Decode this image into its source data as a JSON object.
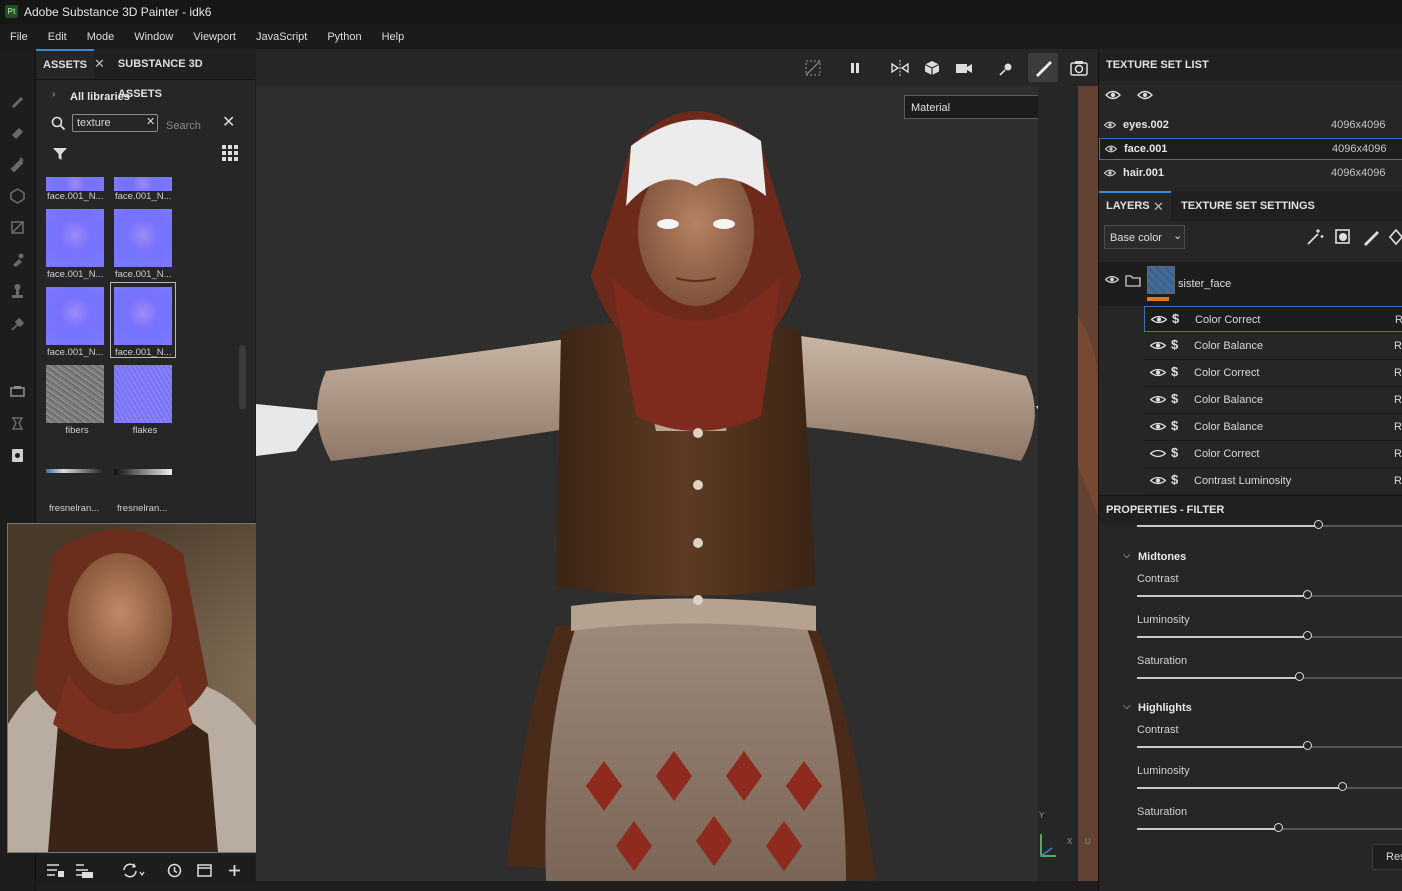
{
  "app": {
    "title": "Adobe Substance 3D Painter - idk6",
    "logo_text": "Pt"
  },
  "menu": [
    "File",
    "Edit",
    "Mode",
    "Window",
    "Viewport",
    "JavaScript",
    "Python",
    "Help"
  ],
  "assets": {
    "tabs": [
      "ASSETS",
      "SUBSTANCE 3D ASSETS"
    ],
    "breadcrumb": "All libraries",
    "search_value": "texture",
    "search_placeholder": "Search",
    "items": [
      {
        "label": "face.001_N...",
        "type": "normal",
        "cropped": true
      },
      {
        "label": "face.001_N...",
        "type": "normal",
        "cropped": true
      },
      {
        "label": "face.001_N...",
        "type": "normal"
      },
      {
        "label": "face.001_N...",
        "type": "normal"
      },
      {
        "label": "face.001_N...",
        "type": "normal"
      },
      {
        "label": "face.001_N...",
        "type": "normal",
        "selected": true
      },
      {
        "label": "fibers",
        "type": "noise"
      },
      {
        "label": "flakes",
        "type": "flakes"
      },
      {
        "label": "fresnelran...",
        "type": "gradient"
      },
      {
        "label": "fresnelran...",
        "type": "gradient"
      }
    ]
  },
  "viewport": {
    "display_mode": "Material",
    "axis": {
      "y": "Y",
      "x": "X",
      "u": "U"
    }
  },
  "texture_set_list": {
    "title": "TEXTURE SET LIST",
    "sets": [
      {
        "name": "eyes.002",
        "size": "4096x4096"
      },
      {
        "name": "face.001",
        "size": "4096x4096",
        "selected": true
      },
      {
        "name": "hair.001",
        "size": "4096x4096"
      }
    ]
  },
  "layers": {
    "tabs": [
      "LAYERS",
      "TEXTURE SET SETTINGS"
    ],
    "channel": "Base color",
    "group": "sister_face",
    "items": [
      {
        "name": "Color Correct",
        "visible": true,
        "selected": true,
        "blend": "Re"
      },
      {
        "name": "Color Balance",
        "visible": true,
        "blend": "Re"
      },
      {
        "name": "Color Correct",
        "visible": true,
        "blend": "Re"
      },
      {
        "name": "Color Balance",
        "visible": true,
        "blend": "Re"
      },
      {
        "name": "Color Balance",
        "visible": true,
        "blend": "Re"
      },
      {
        "name": "Color Correct",
        "visible": false,
        "blend": "Re"
      },
      {
        "name": "Contrast Luminosity",
        "visible": true,
        "blend": "Re"
      }
    ]
  },
  "properties": {
    "title": "PROPERTIES - FILTER",
    "top_slider": 0.68,
    "groups": [
      {
        "name": "Midtones",
        "params": [
          {
            "label": "Contrast",
            "value": 0.64
          },
          {
            "label": "Luminosity",
            "value": 0.64
          },
          {
            "label": "Saturation",
            "value": 0.61
          }
        ]
      },
      {
        "name": "Highlights",
        "params": [
          {
            "label": "Contrast",
            "value": 0.64
          },
          {
            "label": "Luminosity",
            "value": 0.77
          },
          {
            "label": "Saturation",
            "value": 0.53
          }
        ]
      }
    ],
    "reset_label": "Res"
  },
  "colors": {
    "accent": "#3a8ad6",
    "layer_mask_bar": "#e07a1f",
    "normal_map": "#7474ff"
  }
}
